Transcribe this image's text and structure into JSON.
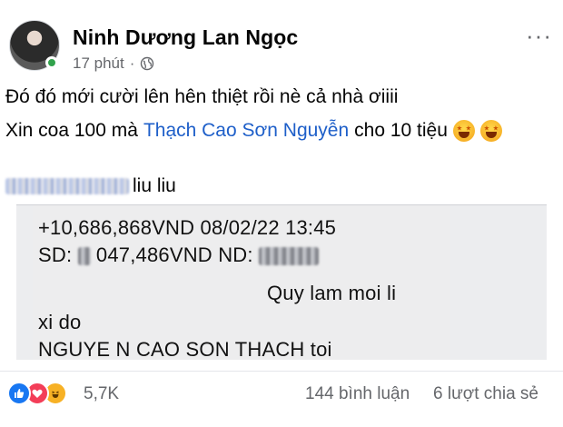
{
  "post": {
    "author": "Ninh Dương Lan Ngọc",
    "time": "17 phút",
    "separator": "·",
    "more_label": "···",
    "text_line1": "Đó đó mới cười lên hên thiệt rồi nè cả nhà ơiiii",
    "text_line2_prefix": "Xin coa 100 mà",
    "text_line2_tag": "Thạch Cao Sơn Nguyễn",
    "text_line2_suffix": "cho 10 tiệu",
    "text_line3_suffix": "liu liu"
  },
  "receipt": {
    "line1": "+10,686,868VND 08/02/22 13:45",
    "line2_prefix": "SD:",
    "line2_middle": "047,486VND ND:",
    "line3": "Quy lam moi li",
    "line4": "xi do",
    "line5": "NGUYE N CAO SON THACH toi"
  },
  "footer": {
    "reaction_count": "5,7K",
    "comments": "144 bình luận",
    "shares": "6 lượt chia sẻ"
  },
  "colors": {
    "link": "#1e5fc9",
    "like": "#1877f2",
    "love": "#f33e58",
    "online": "#31a24c"
  }
}
